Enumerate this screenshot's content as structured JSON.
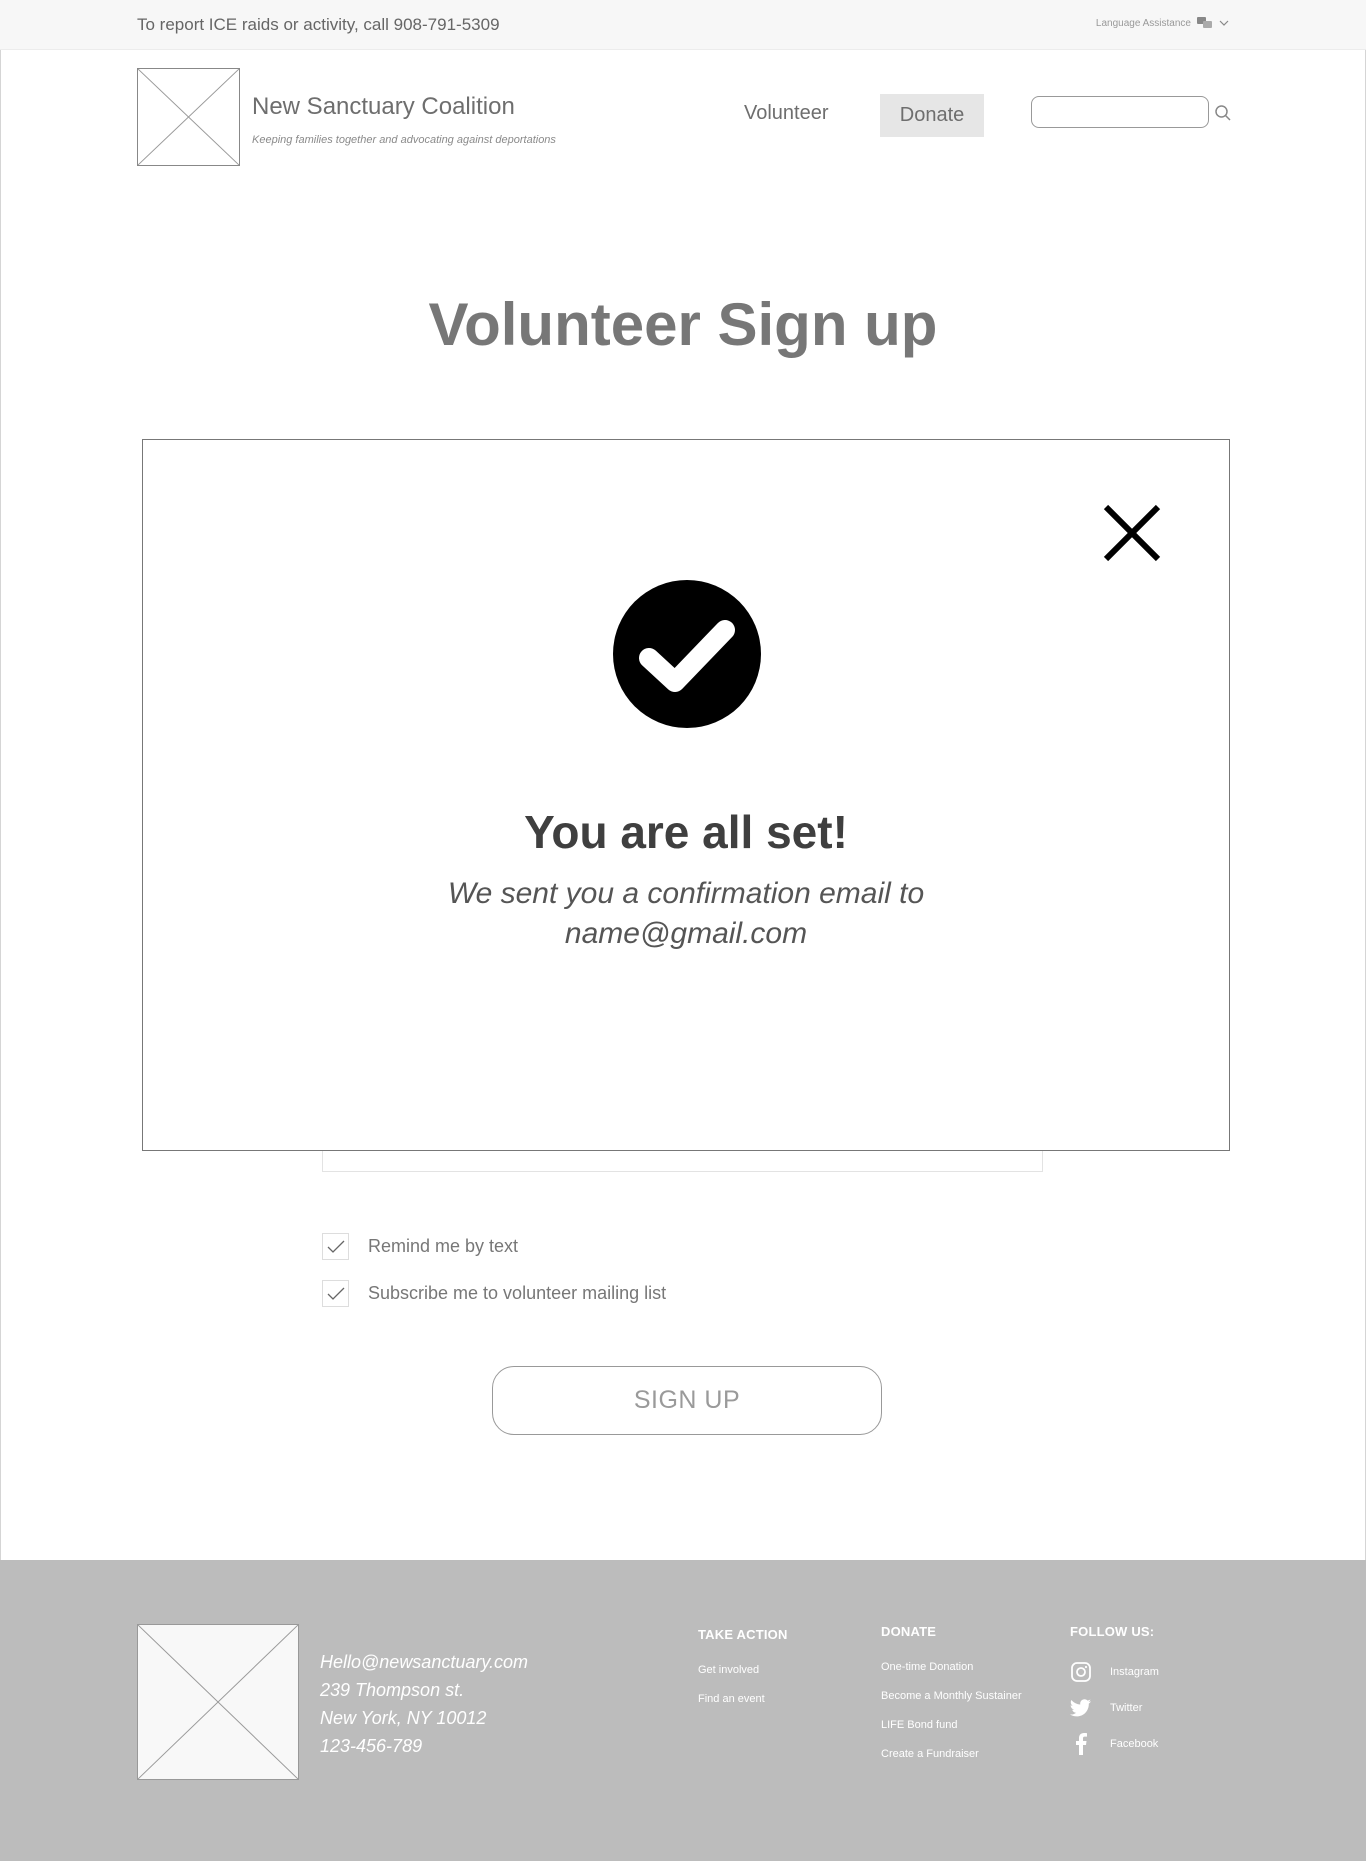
{
  "topbar": {
    "report_text": "To report ICE raids or activity, call 908-791-5309",
    "language_label": "Language Assistance"
  },
  "header": {
    "brand_name": "New Sanctuary Coalition",
    "tagline": "Keeping families together and advocating against deportations",
    "nav_volunteer": "Volunteer",
    "nav_donate": "Donate",
    "search_placeholder": ""
  },
  "page": {
    "title": "Volunteer Sign up"
  },
  "form": {
    "remind_label": "Remind me by text",
    "subscribe_label": "Subscribe me to volunteer mailing list",
    "signup_label": "SIGN UP"
  },
  "modal": {
    "title": "You are all set!",
    "message_line1": "We sent you a confirmation email to",
    "message_line2": "name@gmail.com"
  },
  "footer": {
    "email": "Hello@newsanctuary.com",
    "address1": "239 Thompson st.",
    "address2": "New York, NY 10012",
    "phone": "123-456-789",
    "take_action": {
      "heading": "TAKE ACTION",
      "links": [
        "Get involved",
        "Find an event"
      ]
    },
    "donate": {
      "heading": "DONATE",
      "links": [
        "One-time Donation",
        "Become a Monthly Sustainer",
        "LIFE Bond fund",
        "Create a Fundraiser"
      ]
    },
    "follow": {
      "heading": "FOLLOW US:",
      "links": [
        "Instagram",
        "Twitter",
        "Facebook"
      ]
    }
  },
  "icons": {
    "check_circle": "check-circle-icon",
    "close": "close-icon",
    "search": "search-icon",
    "language": "language-icon",
    "instagram": "instagram-icon",
    "twitter": "twitter-icon",
    "facebook": "facebook-icon"
  }
}
